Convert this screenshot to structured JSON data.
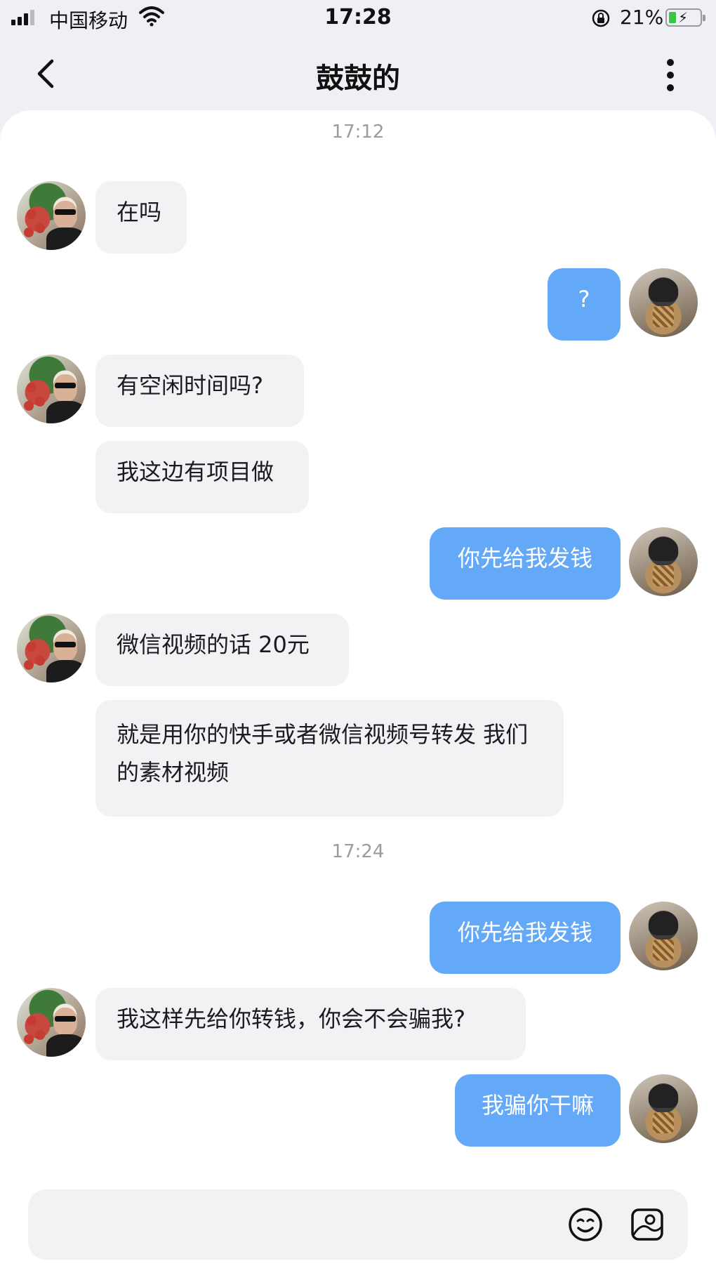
{
  "status_bar": {
    "carrier": "中国移动",
    "time": "17:28",
    "battery_percent": "21%",
    "icons": [
      "signal-icon",
      "wifi-icon",
      "orientation-lock-icon",
      "battery-charging-icon"
    ]
  },
  "header": {
    "title": "鼓鼓的",
    "icons": [
      "back-arrow-icon",
      "more-vertical-icon"
    ]
  },
  "timestamps": [
    "17:12",
    "17:24"
  ],
  "messages": [
    {
      "from": "them",
      "text": "在吗"
    },
    {
      "from": "me",
      "text": "?"
    },
    {
      "from": "them",
      "text": "有空闲时间吗?"
    },
    {
      "from": "them",
      "text": "我这边有项目做"
    },
    {
      "from": "me",
      "text": "你先给我发钱"
    },
    {
      "from": "them",
      "text": "微信视频的话 20元"
    },
    {
      "from": "them",
      "text": "就是用你的快手或者微信视频号转发 我们的素材视频"
    },
    {
      "from": "me",
      "text": "你先给我发钱"
    },
    {
      "from": "them",
      "text": "我这样先给你转钱，你会不会骗我?"
    },
    {
      "from": "me",
      "text": "我骗你干嘛"
    }
  ],
  "input_bar": {
    "value": "",
    "icons": [
      "emoji-icon",
      "sticker-icon"
    ]
  },
  "colors": {
    "outgoing_bubble": "#64a9f8",
    "incoming_bubble": "#f2f2f5",
    "background": "#eef0f5",
    "battery_green": "#39c645"
  }
}
